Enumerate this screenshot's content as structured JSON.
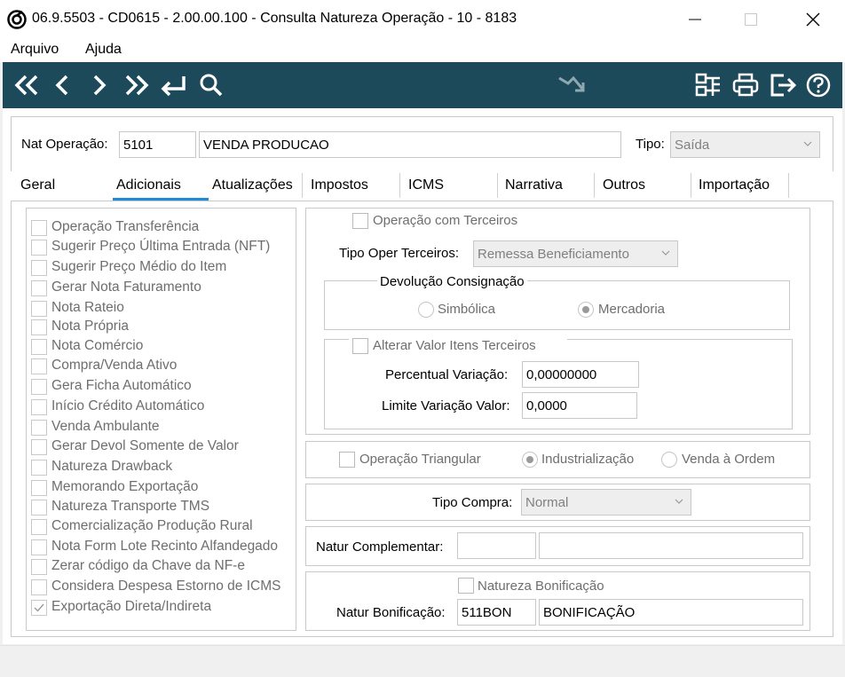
{
  "window": {
    "title": "06.9.5503 - CD0615 - 2.00.00.100 - Consulta Natureza Operação - 10 - 8183",
    "minimize_icon": "minimize-icon",
    "maximize_icon": "maximize-icon",
    "close_icon": "close-icon"
  },
  "menu": [
    "Arquivo",
    "Ajuda"
  ],
  "toolbar": {
    "icons": [
      "first-icon",
      "previous-icon",
      "next-icon",
      "last-icon",
      "return-icon",
      "search-icon",
      "merge-icon",
      "tree-icon",
      "print-icon",
      "exit-icon",
      "help-icon"
    ],
    "color": "#1c4a5a"
  },
  "header": {
    "nat_label": "Nat Operação:",
    "nat_code": "5101",
    "nat_desc": "VENDA PRODUCAO",
    "tipo_label": "Tipo:",
    "tipo_value": "Saída"
  },
  "tabs": [
    "Geral",
    "Adicionais",
    "Atualizações",
    "Impostos",
    "ICMS",
    "Narrativa",
    "Outros",
    "Importação"
  ],
  "active_tab": "Adicionais",
  "left_checks": [
    {
      "label": "Operação Transferência",
      "checked": false
    },
    {
      "label": "Sugerir Preço Última Entrada (NFT)",
      "checked": false
    },
    {
      "label": "Sugerir Preço Médio do Item",
      "checked": false
    },
    {
      "label": "Gerar Nota Faturamento",
      "checked": false
    },
    {
      "label": "Nota Rateio",
      "checked": false
    },
    {
      "label": "Nota Própria",
      "checked": false
    },
    {
      "label": "Nota Comércio",
      "checked": false
    },
    {
      "label": "Compra/Venda Ativo",
      "checked": false
    },
    {
      "label": "Gera Ficha Automático",
      "checked": false
    },
    {
      "label": "Início Crédito Automático",
      "checked": false
    },
    {
      "label": "Venda Ambulante",
      "checked": false
    },
    {
      "label": "Gerar Devol Somente de Valor",
      "checked": false
    },
    {
      "label": "Natureza Drawback",
      "checked": false
    },
    {
      "label": "Memorando Exportação",
      "checked": false
    },
    {
      "label": "Natureza Transporte TMS",
      "checked": false
    },
    {
      "label": "Comercialização Produção Rural",
      "checked": false
    },
    {
      "label": "Nota Form Lote Recinto Alfandegado",
      "checked": false
    },
    {
      "label": "Zerar código da Chave da NF-e",
      "checked": false
    },
    {
      "label": "Considera Despesa Estorno de ICMS",
      "checked": false
    },
    {
      "label": "Exportação Direta/Indireta",
      "checked": true
    }
  ],
  "terceiros": {
    "op_terceiros_label": "Operação com Terceiros",
    "tipo_oper_label": "Tipo Oper Terceiros:",
    "tipo_oper_value": "Remessa Beneficiamento",
    "devolucao_title": "Devolução Consignação",
    "radio_simbolica": "Simbólica",
    "radio_mercadoria": "Mercadoria",
    "alterar_label": "Alterar Valor Itens Terceiros",
    "percentual_label": "Percentual Variação:",
    "percentual_value": "0,00000000",
    "limite_label": "Limite Variação Valor:",
    "limite_value": "0,0000"
  },
  "triangular": {
    "label": "Operação Triangular",
    "radio_industrializacao": "Industrialização",
    "radio_venda_ordem": "Venda à Ordem"
  },
  "compra": {
    "label": "Tipo Compra:",
    "value": "Normal"
  },
  "complementar": {
    "label": "Natur Complementar:",
    "code": "",
    "desc": ""
  },
  "bonificacao": {
    "check_label": "Natureza Bonificação",
    "label": "Natur Bonificação:",
    "code": "511BON",
    "desc": "BONIFICAÇÃO"
  }
}
